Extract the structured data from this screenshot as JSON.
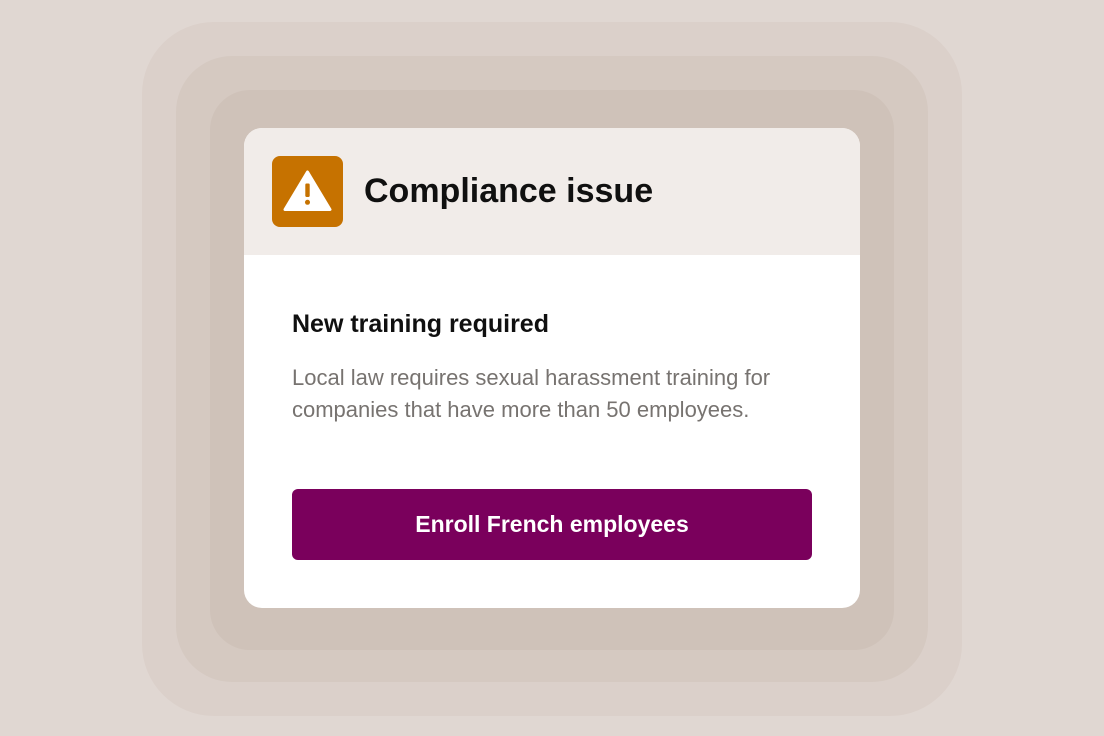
{
  "colors": {
    "background": "#e0d7d2",
    "card_header": "#f1ece9",
    "warning_badge": "#c67200",
    "button": "#7a005c"
  },
  "alert": {
    "icon": "warning-triangle-icon",
    "title": "Compliance issue"
  },
  "notice": {
    "heading": "New training required",
    "body": "Local law requires sexual harassment training for companies that have more than 50 employees."
  },
  "actions": {
    "enroll_label": "Enroll French employees"
  }
}
